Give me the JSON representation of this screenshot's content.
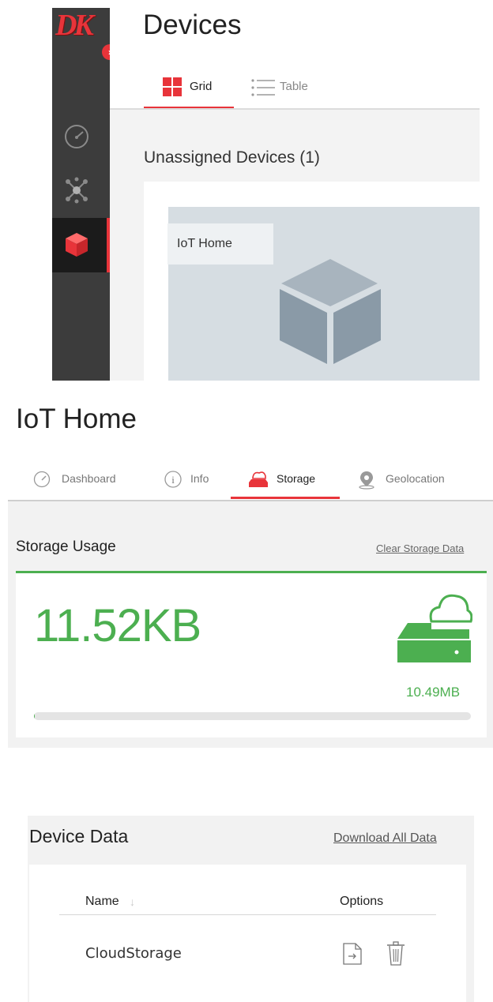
{
  "devices_view": {
    "logo_text": "DK",
    "title": "Devices",
    "tabs": [
      {
        "label": "Grid",
        "active": true
      },
      {
        "label": "Table",
        "active": false
      }
    ],
    "section_heading": "Unassigned Devices (1)",
    "device_card": {
      "label": "IoT Home",
      "icon": "cube-icon"
    },
    "sidebar_icons": [
      "gauge-icon",
      "network-icon",
      "cube-icon"
    ],
    "active_sidebar_item": "cube-icon"
  },
  "device_detail": {
    "title": "IoT Home",
    "tabs": [
      {
        "label": "Dashboard",
        "icon": "gauge-icon",
        "active": false
      },
      {
        "label": "Info",
        "icon": "info-icon",
        "active": false
      },
      {
        "label": "Storage",
        "icon": "storage-icon",
        "active": true
      },
      {
        "label": "Geolocation",
        "icon": "location-pin-icon",
        "active": false
      }
    ],
    "storage": {
      "heading": "Storage Usage",
      "clear_link": "Clear Storage Data",
      "used": "11.52KB",
      "capacity": "10.49MB",
      "used_fraction": 0.0011,
      "icon": "cloud-drive-icon"
    }
  },
  "device_data": {
    "heading": "Device Data",
    "download_link": "Download All Data",
    "columns": [
      "Name",
      "Options"
    ],
    "sort_indicator": "↓",
    "rows": [
      {
        "name": "CloudStorage",
        "options": [
          "export-icon",
          "trash-icon"
        ]
      }
    ]
  },
  "colors": {
    "accent_red": "#e8343a",
    "success_green": "#4caf50",
    "sidebar_dark": "#3c3c3c"
  }
}
